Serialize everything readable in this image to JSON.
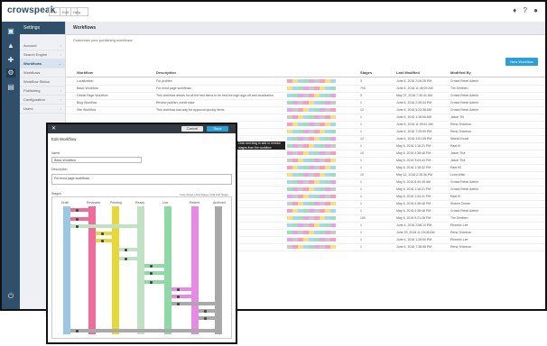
{
  "app": {
    "logo": "crowspeak",
    "tabs": [
      "File",
      "Edit",
      "Help"
    ],
    "top_icons": [
      "bell-icon",
      "help-icon",
      "user-icon"
    ]
  },
  "rail": {
    "icons": [
      "home-icon",
      "chart-icon",
      "graph-icon",
      "gear-icon",
      "cart-icon",
      "power-icon"
    ]
  },
  "sidebar": {
    "header": "Settings",
    "items": [
      {
        "label": "Account",
        "active": false
      },
      {
        "label": "Search Engine",
        "active": false
      },
      {
        "label": "Workflows",
        "active": true
      },
      {
        "label": "Workflows",
        "active": false
      },
      {
        "label": "Workflow Status",
        "active": false
      },
      {
        "label": "Publishing",
        "active": false
      },
      {
        "label": "Configuration",
        "active": false
      },
      {
        "label": "Users",
        "active": false
      }
    ]
  },
  "main": {
    "title": "Workflows",
    "subtitle": "Customize your publishing workflows",
    "create_button": "New Workflow",
    "columns": [
      "Workflow",
      "Description",
      "",
      "Stages",
      "Last Modified",
      "Modified By"
    ],
    "rows": [
      {
        "name": "Localization",
        "desc": "For profiles",
        "stages": "3",
        "modified": "June 8, 2016 2:06:28 PM",
        "by": "Crowd Rebel Admin"
      },
      {
        "name": "Basic Workflow",
        "desc": "For most page workflows",
        "stages": "700",
        "modified": "June 8, 2016 11:46:09 AM",
        "by": "Tim Smithen"
      },
      {
        "name": "Global Page Workflow",
        "desc": "This workflow allows for all the test items to be held through sign-off and localization",
        "stages": "3",
        "modified": "May 27, 2016 7:30:41 AM",
        "by": "Crowd Rebel Admin"
      },
      {
        "name": "Blog Workflow",
        "desc": "Review publish, credit ease",
        "stages": "1",
        "modified": "June 8, 2016 2:39:44 PM",
        "by": "Crowd Rebel Admin"
      },
      {
        "name": "Site Workflow",
        "desc": "This workflow has way for approval quickly items",
        "stages": "12",
        "modified": "June 6, 2016 5:23:38 AM",
        "by": "Crowd Rebel Admin"
      },
      {
        "name": "",
        "desc": "",
        "stages": "1",
        "modified": "June 6, 2016 1:18:06 AM",
        "by": "Jason Thi"
      },
      {
        "name": "",
        "desc": "",
        "stages": "1",
        "modified": "June 8, 2016 11:09:41 AM",
        "by": "Rend Shannon"
      },
      {
        "name": "",
        "desc": "",
        "stages": "1",
        "modified": "June 6, 2016 7:25:05 PM",
        "by": "Rend Shannon"
      },
      {
        "name": "",
        "desc": "",
        "stages": "12",
        "modified": "June 6, 2016 3:51:08 PM",
        "by": "Michel Kozat"
      },
      {
        "name": "",
        "desc": "",
        "stages": "1",
        "modified": "May 5, 2016 1:16:21 PM",
        "by": "Rael Ki"
      },
      {
        "name": "",
        "desc": "",
        "stages": "10",
        "modified": "May 5, 2016 4:38:46 PM",
        "by": "Jason Tha"
      },
      {
        "name": "",
        "desc": "",
        "stages": "1",
        "modified": "May 5, 2016 3:04:44 PM",
        "by": "Jason Tha"
      },
      {
        "name": "",
        "desc": "",
        "stages": "1",
        "modified": "May 5, 2016 1:18:32 PM",
        "by": "Rael Kil"
      },
      {
        "name": "",
        "desc": "",
        "stages": "10",
        "modified": "May 12, 2016 2:28:36 PM",
        "by": "Loris Wiler"
      },
      {
        "name": "",
        "desc": "",
        "stages": "1",
        "modified": "May 5, 2016 8:40:49 AM",
        "by": "Crowd Rebel Admin"
      },
      {
        "name": "",
        "desc": "",
        "stages": "1",
        "modified": "May 5, 2016 1:16:21 PM",
        "by": "Crowd Rebel Admin"
      },
      {
        "name": "",
        "desc": "",
        "stages": "1",
        "modified": "May 5, 2016 1:34:41 PM",
        "by": "Rael Ki"
      },
      {
        "name": "",
        "desc": "",
        "stages": "1",
        "modified": "May 5, 2016 4:38:46 PM",
        "by": "Shawn Ocean"
      },
      {
        "name": "",
        "desc": "",
        "stages": "1",
        "modified": "May 5, 2016 4:38:46 PM",
        "by": "Crowd Rebel Admin"
      },
      {
        "name": "",
        "desc": "",
        "stages": "100",
        "modified": "May 5, 2016 9:21:28 PM",
        "by": "Tim Smithen"
      },
      {
        "name": "",
        "desc": "",
        "stages": "1",
        "modified": "June 4, 2016 2:58:10 PM",
        "by": "Phoenix Lee"
      },
      {
        "name": "",
        "desc": "",
        "stages": "1",
        "modified": "June 20, 2016 11:15:08 AM",
        "by": "Rend Shannon"
      },
      {
        "name": "",
        "desc": "",
        "stages": "1",
        "modified": "June 6, 2016 1:28:50 PM",
        "by": "Phoenix Lee"
      },
      {
        "name": "",
        "desc": "",
        "stages": "1",
        "modified": "June 6, 2016 7:38:58 PM",
        "by": "Rend Shannon"
      }
    ]
  },
  "tooltip": "Click and drag to add or remove stages from the workflow",
  "popup": {
    "cancel": "Cancel",
    "save": "Save",
    "title": "Edit Workflow",
    "name_label": "Name",
    "name_value": "Basic Workflow",
    "desc_label": "Description",
    "desc_value": "For most page workflows",
    "stages_label": "Stages",
    "stage_options": "View Stage | Add Stage | Add Sub Stage",
    "stage_columns": [
      "Draft",
      "Reviewed",
      "Pending",
      "Ready",
      "Live",
      "Retired",
      "Archived"
    ],
    "stage_colors": [
      "#9ac8e2",
      "#f06a9a",
      "#e7d83a",
      "#bfe3c2",
      "#8fd9a6",
      "#e78ae6",
      "#a9a9a9"
    ]
  }
}
